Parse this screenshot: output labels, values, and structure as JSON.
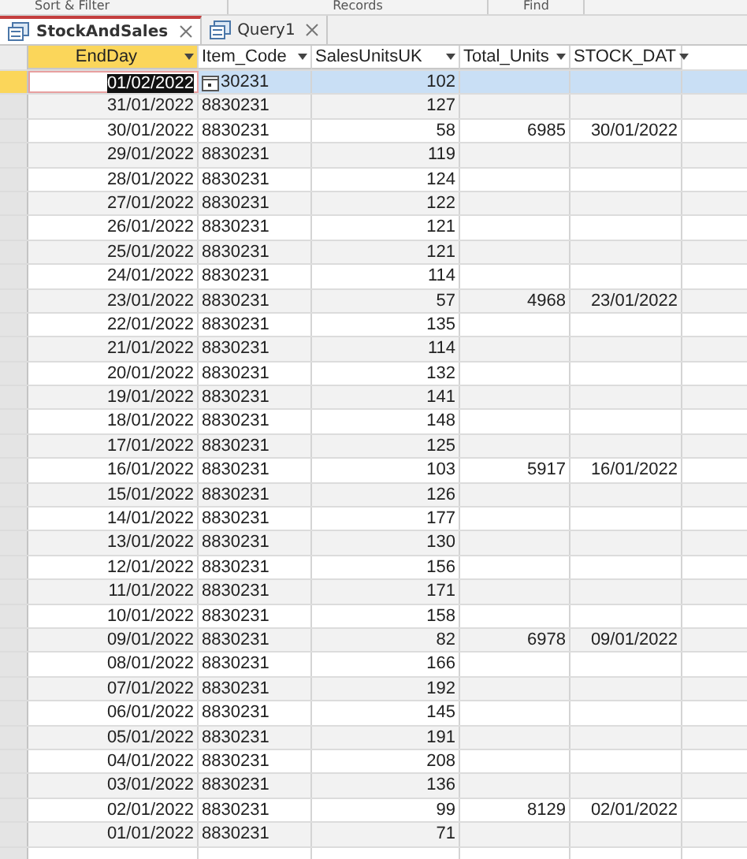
{
  "ribbon_groups": [
    "Sort & Filter",
    "Records",
    "Find"
  ],
  "tabs": [
    {
      "label": "StockAndSales",
      "selected": true
    },
    {
      "label": "Query1",
      "selected": false
    }
  ],
  "columns": [
    "EndDay",
    "Item_Code",
    "SalesUnitsUK",
    "Total_Units",
    "STOCK_DAT"
  ],
  "rows": [
    {
      "selected": true,
      "editing": true,
      "cells": [
        "01/02/2022",
        "30231",
        "102",
        "",
        ""
      ]
    },
    {
      "selected": false,
      "editing": false,
      "cells": [
        "31/01/2022",
        "8830231",
        "127",
        "",
        ""
      ]
    },
    {
      "selected": false,
      "editing": false,
      "cells": [
        "30/01/2022",
        "8830231",
        "58",
        "6985",
        "30/01/2022"
      ]
    },
    {
      "selected": false,
      "editing": false,
      "cells": [
        "29/01/2022",
        "8830231",
        "119",
        "",
        ""
      ]
    },
    {
      "selected": false,
      "editing": false,
      "cells": [
        "28/01/2022",
        "8830231",
        "124",
        "",
        ""
      ]
    },
    {
      "selected": false,
      "editing": false,
      "cells": [
        "27/01/2022",
        "8830231",
        "122",
        "",
        ""
      ]
    },
    {
      "selected": false,
      "editing": false,
      "cells": [
        "26/01/2022",
        "8830231",
        "121",
        "",
        ""
      ]
    },
    {
      "selected": false,
      "editing": false,
      "cells": [
        "25/01/2022",
        "8830231",
        "121",
        "",
        ""
      ]
    },
    {
      "selected": false,
      "editing": false,
      "cells": [
        "24/01/2022",
        "8830231",
        "114",
        "",
        ""
      ]
    },
    {
      "selected": false,
      "editing": false,
      "cells": [
        "23/01/2022",
        "8830231",
        "57",
        "4968",
        "23/01/2022"
      ]
    },
    {
      "selected": false,
      "editing": false,
      "cells": [
        "22/01/2022",
        "8830231",
        "135",
        "",
        ""
      ]
    },
    {
      "selected": false,
      "editing": false,
      "cells": [
        "21/01/2022",
        "8830231",
        "114",
        "",
        ""
      ]
    },
    {
      "selected": false,
      "editing": false,
      "cells": [
        "20/01/2022",
        "8830231",
        "132",
        "",
        ""
      ]
    },
    {
      "selected": false,
      "editing": false,
      "cells": [
        "19/01/2022",
        "8830231",
        "141",
        "",
        ""
      ]
    },
    {
      "selected": false,
      "editing": false,
      "cells": [
        "18/01/2022",
        "8830231",
        "148",
        "",
        ""
      ]
    },
    {
      "selected": false,
      "editing": false,
      "cells": [
        "17/01/2022",
        "8830231",
        "125",
        "",
        ""
      ]
    },
    {
      "selected": false,
      "editing": false,
      "cells": [
        "16/01/2022",
        "8830231",
        "103",
        "5917",
        "16/01/2022"
      ]
    },
    {
      "selected": false,
      "editing": false,
      "cells": [
        "15/01/2022",
        "8830231",
        "126",
        "",
        ""
      ]
    },
    {
      "selected": false,
      "editing": false,
      "cells": [
        "14/01/2022",
        "8830231",
        "177",
        "",
        ""
      ]
    },
    {
      "selected": false,
      "editing": false,
      "cells": [
        "13/01/2022",
        "8830231",
        "130",
        "",
        ""
      ]
    },
    {
      "selected": false,
      "editing": false,
      "cells": [
        "12/01/2022",
        "8830231",
        "156",
        "",
        ""
      ]
    },
    {
      "selected": false,
      "editing": false,
      "cells": [
        "11/01/2022",
        "8830231",
        "171",
        "",
        ""
      ]
    },
    {
      "selected": false,
      "editing": false,
      "cells": [
        "10/01/2022",
        "8830231",
        "158",
        "",
        ""
      ]
    },
    {
      "selected": false,
      "editing": false,
      "cells": [
        "09/01/2022",
        "8830231",
        "82",
        "6978",
        "09/01/2022"
      ]
    },
    {
      "selected": false,
      "editing": false,
      "cells": [
        "08/01/2022",
        "8830231",
        "166",
        "",
        ""
      ]
    },
    {
      "selected": false,
      "editing": false,
      "cells": [
        "07/01/2022",
        "8830231",
        "192",
        "",
        ""
      ]
    },
    {
      "selected": false,
      "editing": false,
      "cells": [
        "06/01/2022",
        "8830231",
        "145",
        "",
        ""
      ]
    },
    {
      "selected": false,
      "editing": false,
      "cells": [
        "05/01/2022",
        "8830231",
        "191",
        "",
        ""
      ]
    },
    {
      "selected": false,
      "editing": false,
      "cells": [
        "04/01/2022",
        "8830231",
        "208",
        "",
        ""
      ]
    },
    {
      "selected": false,
      "editing": false,
      "cells": [
        "03/01/2022",
        "8830231",
        "136",
        "",
        ""
      ]
    },
    {
      "selected": false,
      "editing": false,
      "cells": [
        "02/01/2022",
        "8830231",
        "99",
        "8129",
        "02/01/2022"
      ]
    },
    {
      "selected": false,
      "editing": false,
      "cells": [
        "01/01/2022",
        "8830231",
        "71",
        "",
        ""
      ]
    }
  ]
}
